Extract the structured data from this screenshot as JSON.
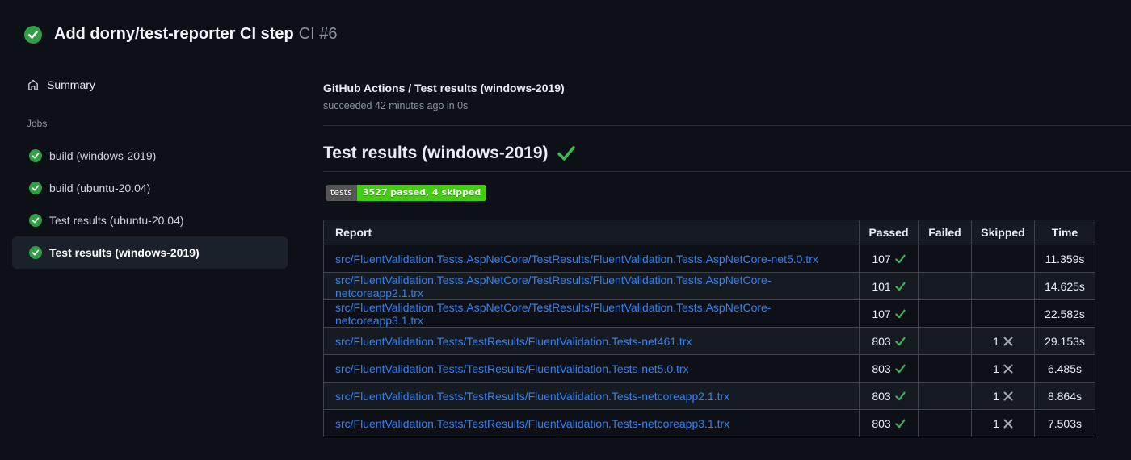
{
  "header": {
    "title": "Add dorny/test-reporter CI step",
    "run_number": "CI #6"
  },
  "sidebar": {
    "summary_label": "Summary",
    "jobs_label": "Jobs",
    "jobs": [
      {
        "label": "build (windows-2019)",
        "status": "success",
        "selected": false
      },
      {
        "label": "build (ubuntu-20.04)",
        "status": "success",
        "selected": false
      },
      {
        "label": "Test results (ubuntu-20.04)",
        "status": "success",
        "selected": false
      },
      {
        "label": "Test results (windows-2019)",
        "status": "success",
        "selected": true
      }
    ]
  },
  "main": {
    "check_title": "GitHub Actions / Test results (windows-2019)",
    "check_status": "succeeded 42 minutes ago in 0s",
    "section_heading": "Test results (windows-2019)",
    "section_status_icon": "check-mark",
    "badge": {
      "label": "tests",
      "value": "3527 passed, 4 skipped"
    },
    "table": {
      "columns": [
        "Report",
        "Passed",
        "Failed",
        "Skipped",
        "Time"
      ],
      "rows": [
        {
          "report": "src/FluentValidation.Tests.AspNetCore/TestResults/FluentValidation.Tests.AspNetCore-net5.0.trx",
          "passed": "107",
          "failed": "",
          "skipped": "",
          "time": "11.359s"
        },
        {
          "report": "src/FluentValidation.Tests.AspNetCore/TestResults/FluentValidation.Tests.AspNetCore-netcoreapp2.1.trx",
          "passed": "101",
          "failed": "",
          "skipped": "",
          "time": "14.625s"
        },
        {
          "report": "src/FluentValidation.Tests.AspNetCore/TestResults/FluentValidation.Tests.AspNetCore-netcoreapp3.1.trx",
          "passed": "107",
          "failed": "",
          "skipped": "",
          "time": "22.582s"
        },
        {
          "report": "src/FluentValidation.Tests/TestResults/FluentValidation.Tests-net461.trx",
          "passed": "803",
          "failed": "",
          "skipped": "1",
          "time": "29.153s"
        },
        {
          "report": "src/FluentValidation.Tests/TestResults/FluentValidation.Tests-net5.0.trx",
          "passed": "803",
          "failed": "",
          "skipped": "1",
          "time": "6.485s"
        },
        {
          "report": "src/FluentValidation.Tests/TestResults/FluentValidation.Tests-netcoreapp2.1.trx",
          "passed": "803",
          "failed": "",
          "skipped": "1",
          "time": "8.864s"
        },
        {
          "report": "src/FluentValidation.Tests/TestResults/FluentValidation.Tests-netcoreapp3.1.trx",
          "passed": "803",
          "failed": "",
          "skipped": "1",
          "time": "7.503s"
        }
      ]
    }
  },
  "colors": {
    "background": "#0d1117",
    "accent_green": "#2ea043",
    "check_green": "#3fb950",
    "link_blue": "#2f81f7",
    "badge_label_bg": "#555555",
    "badge_value_bg": "#44cc11"
  }
}
